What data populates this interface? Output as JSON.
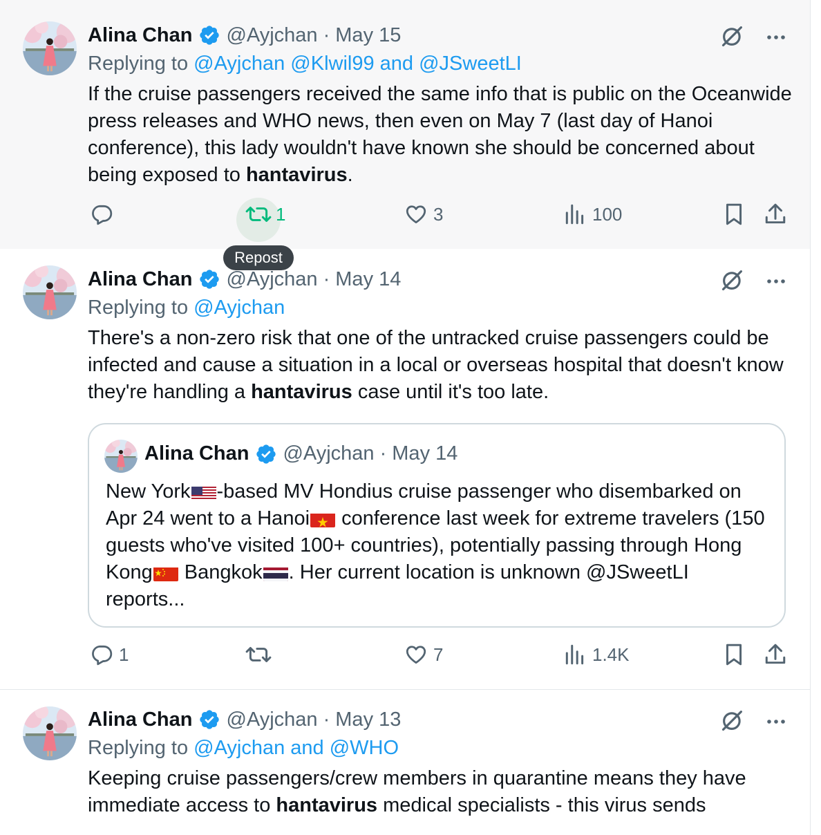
{
  "colors": {
    "accent": "#1d9bf0",
    "repost_active": "#00ba7c",
    "verified": "#1d9bf0"
  },
  "tweets": [
    {
      "name": "Alina Chan",
      "handle": "@Ayjchan",
      "date": "· May 15",
      "replying_label": "Replying to ",
      "replying_to": "@Ayjchan @Klwil99 and @JSweetLI",
      "text_before": "If the cruise passengers received the same info that is public on the Oceanwide press releases and WHO news, then even on May 7 (last day of Hanoi conference), this lady wouldn't have known she should be concerned about being exposed to ",
      "text_bold": "hantavirus",
      "text_after": ".",
      "replies": "",
      "reposts": "1",
      "likes": "3",
      "views": "100"
    },
    {
      "name": "Alina Chan",
      "handle": "@Ayjchan",
      "date": "· May 14",
      "replying_label": "Replying to ",
      "replying_to": "@Ayjchan",
      "text_before": "There's a non-zero risk that one of the untracked cruise passengers could be infected and cause a situation in a local or overseas hospital that doesn't know they're handling a ",
      "text_bold": "hantavirus",
      "text_after": " case until it's too late.",
      "quote": {
        "name": "Alina Chan",
        "handle": "@Ayjchan",
        "date": "· May 14",
        "p1": "New York",
        "p2": "-based MV Hondius cruise passenger who disembarked on Apr 24 went to a Hanoi",
        "p3": " conference last week for extreme travelers (150 guests who've visited 100+ countries), potentially passing through Hong Kong",
        "p4": " Bangkok",
        "p5": ". Her current location is unknown @JSweetLI reports..."
      },
      "replies": "1",
      "reposts": "",
      "likes": "7",
      "views": "1.4K"
    },
    {
      "name": "Alina Chan",
      "handle": "@Ayjchan",
      "date": "· May 13",
      "replying_label": "Replying to ",
      "replying_to": "@Ayjchan and @WHO",
      "text_before": "Keeping cruise passengers/crew members in quarantine means they have immediate access to ",
      "text_bold": "hantavirus",
      "text_after": " medical specialists - this virus sends"
    }
  ],
  "tooltip": "Repost",
  "icons": [
    "verified-badge-icon",
    "grok-icon",
    "more-icon",
    "reply-icon",
    "repost-icon",
    "like-icon",
    "views-icon",
    "bookmark-icon",
    "share-icon",
    "flag-us-icon",
    "flag-vn-icon",
    "flag-cn-icon",
    "flag-th-icon"
  ]
}
